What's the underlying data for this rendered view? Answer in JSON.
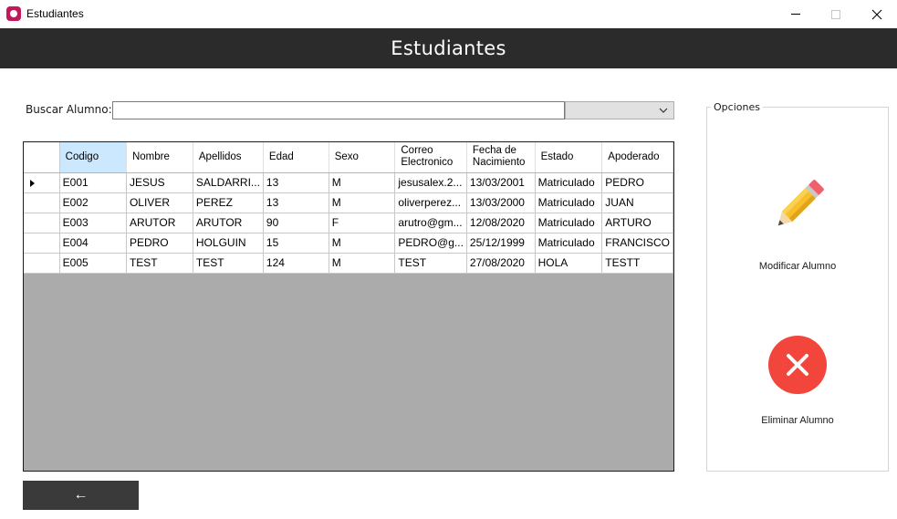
{
  "window": {
    "title": "Estudiantes",
    "minimize_label": "—",
    "close_label": "✕"
  },
  "header": {
    "title": "Estudiantes"
  },
  "search": {
    "label": "Buscar Alumno:",
    "value": "",
    "select_value": ""
  },
  "table": {
    "columns": [
      "Codigo",
      "Nombre",
      "Apellidos",
      "Edad",
      "Sexo",
      "Correo Electronico",
      "Fecha de Nacimiento",
      "Estado",
      "Apoderado"
    ],
    "rows": [
      [
        "E001",
        "JESUS",
        "SALDARRI...",
        "13",
        "M",
        "jesusalex.2...",
        "13/03/2001",
        "Matriculado",
        "PEDRO"
      ],
      [
        "E002",
        "OLIVER",
        "PEREZ",
        "13",
        "M",
        "oliverperez...",
        "13/03/2000",
        "Matriculado",
        "JUAN"
      ],
      [
        "E003",
        "ARUTOR",
        "ARUTOR",
        "90",
        "F",
        "arutro@gm...",
        "12/08/2020",
        "Matriculado",
        "ARTURO"
      ],
      [
        "E004",
        "PEDRO",
        "HOLGUIN",
        "15",
        "M",
        "PEDRO@g...",
        "25/12/1999",
        "Matriculado",
        "FRANCISCO"
      ],
      [
        "E005",
        "TEST",
        "TEST",
        "124",
        "M",
        "TEST",
        "27/08/2020",
        "HOLA",
        "TESTT"
      ]
    ],
    "selected_column": "Codigo",
    "current_row": 0
  },
  "back_button": {
    "label": "←"
  },
  "options": {
    "legend": "Opciones",
    "modify_label": "Modificar Alumno",
    "delete_label": "Eliminar Alumno",
    "modify_icon": "pencil-icon",
    "delete_icon": "delete-x-icon"
  },
  "colors": {
    "header_bg": "#2b2b2b",
    "grid_bg": "#ababab",
    "selected_header": "#cce8ff",
    "delete_red": "#f2463c",
    "pencil_yellow": "#f7c02b"
  }
}
